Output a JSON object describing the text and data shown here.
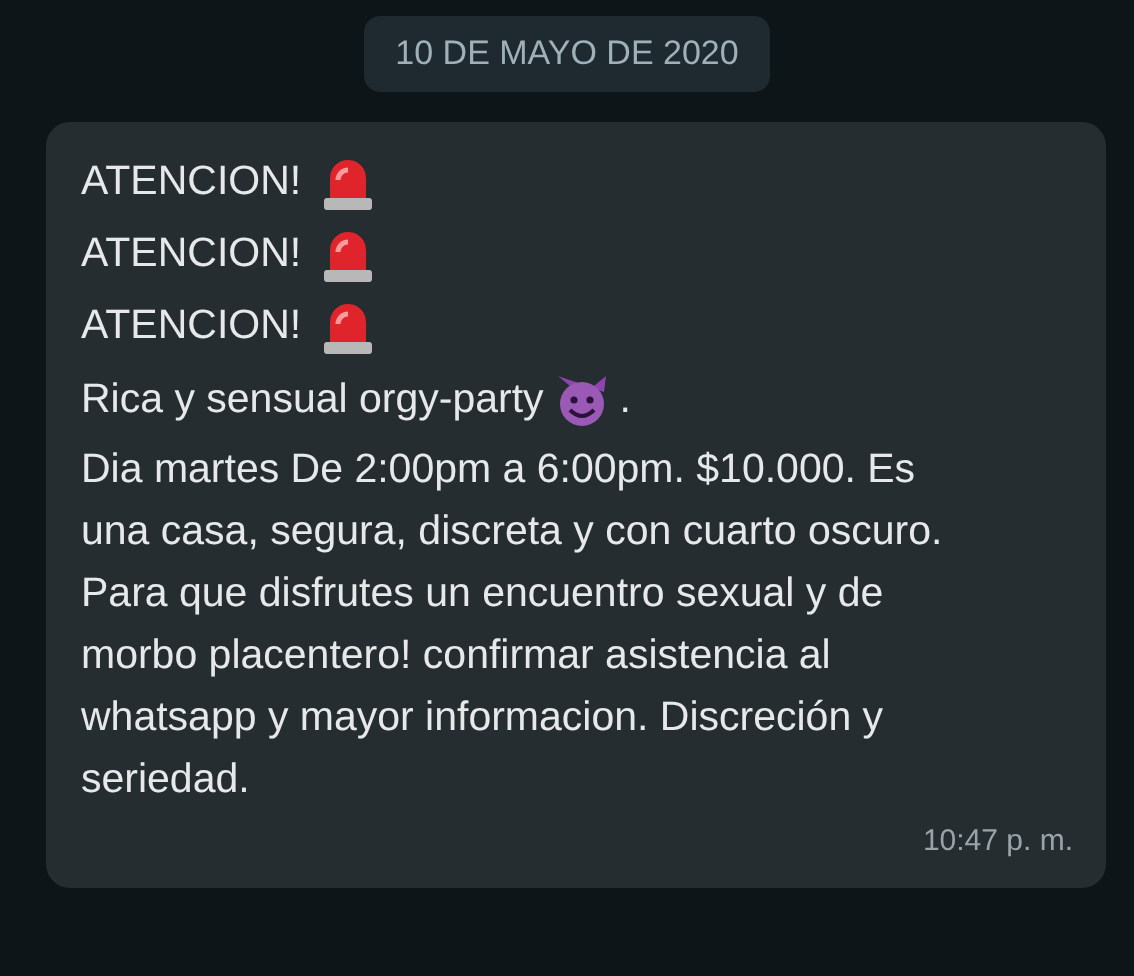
{
  "date_chip": "10 DE MAYO DE 2020",
  "message": {
    "alerts": [
      "ATENCION!",
      "ATENCION!",
      "ATENCION!"
    ],
    "headline": "Rica y sensual orgy-party",
    "headline_end": ".",
    "body": "Dia martes De 2:00pm a 6:00pm. $10.000. Es una casa, segura, discreta y con cuarto oscuro. Para que disfrutes un encuentro sexual y de morbo placentero! confirmar asistencia al whatsapp y mayor informacion. Discreción y seriedad.",
    "time": "10:47 p. m."
  }
}
